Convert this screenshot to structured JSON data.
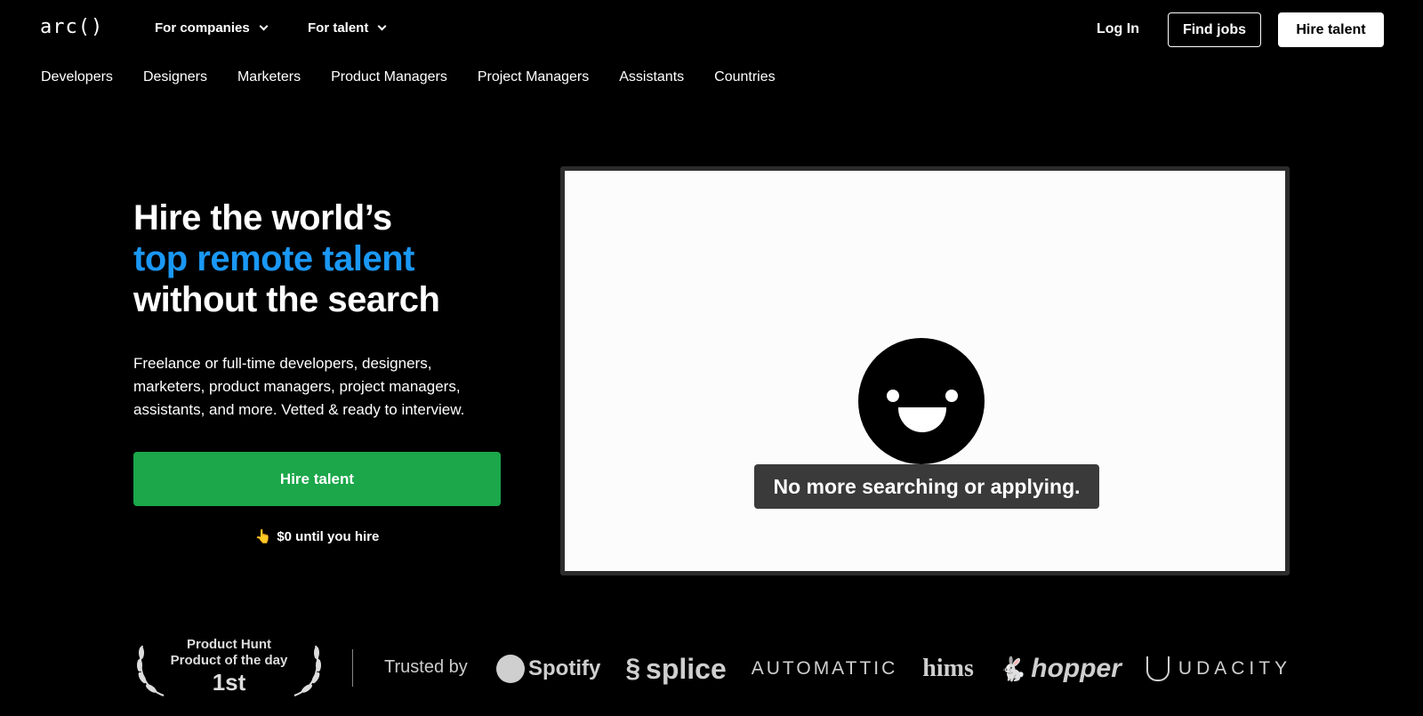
{
  "nav": {
    "logo": "arc()",
    "for_companies": "For companies",
    "for_talent": "For talent",
    "login": "Log In",
    "find_jobs": "Find jobs",
    "hire_talent": "Hire talent"
  },
  "subnav": [
    "Developers",
    "Designers",
    "Marketers",
    "Product Managers",
    "Project Managers",
    "Assistants",
    "Countries"
  ],
  "hero": {
    "title_line1": "Hire the world’s",
    "title_line2": "top remote talent",
    "title_line3": "without the search",
    "description": "Freelance or full-time developers, designers, marketers, product managers, project managers, assistants, and more. Vetted & ready to interview.",
    "cta": "Hire talent",
    "note_icon": "👆",
    "note": "$0 until you hire"
  },
  "video": {
    "caption": "No more searching or applying."
  },
  "badges": {
    "ph_line1": "Product Hunt",
    "ph_line2": "Product of the day",
    "ph_line3": "1st",
    "trusted_by": "Trusted by"
  },
  "logos": {
    "spotify": "Spotify",
    "splice": "splice",
    "automattic": "AUTOMATTIC",
    "hims": "hims",
    "hopper": "hopper",
    "udacity": "UDACITY"
  },
  "colors": {
    "accent": "#1a98f5",
    "cta": "#1ba74a",
    "background": "#000000"
  }
}
